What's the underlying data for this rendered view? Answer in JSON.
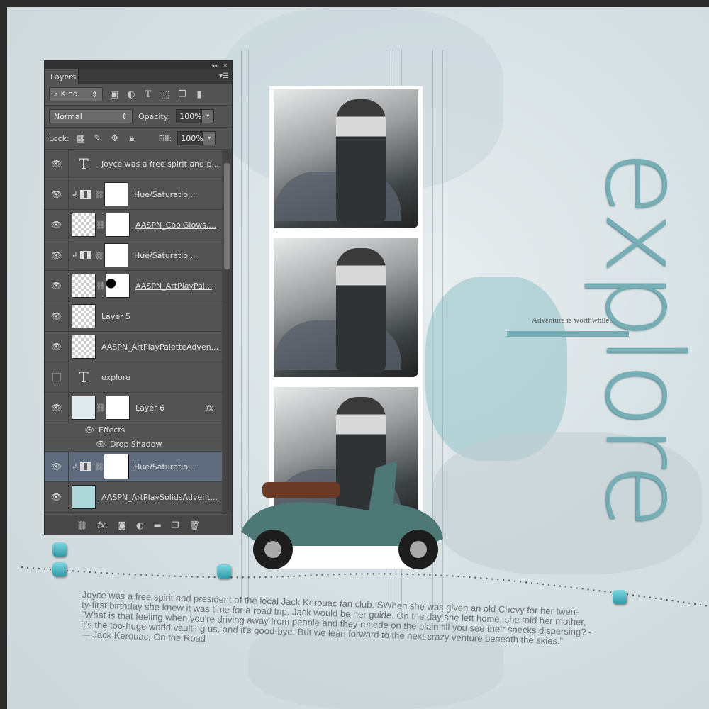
{
  "panel": {
    "tab": "Layers",
    "filter_kind": "Kind",
    "blend_mode": "Normal",
    "opacity_label": "Opacity:",
    "opacity": "100%",
    "lock_label": "Lock:",
    "fill_label": "Fill:",
    "fill": "100%"
  },
  "layers": [
    {
      "name": "Joyce was a free spirit and p...",
      "type": "text",
      "visible": true
    },
    {
      "name": "Hue/Saturatio...",
      "type": "adjustment",
      "visible": true,
      "clipped": true
    },
    {
      "name": "AASPN_CoolGlows....",
      "type": "image-mask",
      "visible": true
    },
    {
      "name": "Hue/Saturatio...",
      "type": "adjustment",
      "visible": true,
      "clipped": true
    },
    {
      "name": "AASPN_ArtPlayPal...",
      "type": "image-mask",
      "visible": true
    },
    {
      "name": "Layer 5",
      "type": "image",
      "visible": true
    },
    {
      "name": "AASPN_ArtPlayPaletteAdven...",
      "type": "image",
      "visible": true
    },
    {
      "name": "explore",
      "type": "text",
      "visible": false
    },
    {
      "name": "Layer 6",
      "type": "image-mask",
      "visible": true,
      "fx": "fx",
      "effects_label": "Effects",
      "effects": [
        "Drop Shadow"
      ]
    },
    {
      "name": "Hue/Saturatio...",
      "type": "adjustment",
      "visible": true,
      "clipped": true,
      "selected": true
    },
    {
      "name": "AASPN_ArtPlaySolidsAdvent...",
      "type": "image",
      "visible": true
    }
  ],
  "artwork": {
    "title": "explore",
    "tagline": "Adventure is worthwhile.",
    "journal": [
      "Joyce was a free spirit and president of the local Jack Kerouac fan club. SWhen she was given an old Chevy for her twen-",
      "ty-first birthday she knew it was time for a road trip. Jack would be her guide. On the day she left home, she told her mother,",
      "“What is that feeling when you're driving away from people and they recede on the plain till you see their specks dispersing? -",
      "it's the too-huge world vaulting us, and it's good-bye. But we lean forward to the next crazy venture beneath the skies.”",
      "— Jack Kerouac, On the Road"
    ],
    "accent": "#77aeb6"
  }
}
